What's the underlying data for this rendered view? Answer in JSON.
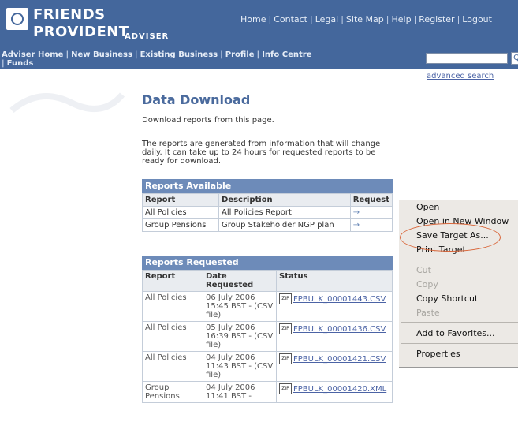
{
  "brand": {
    "name_line1": "FRIENDS",
    "name_line2": "PROVIDENT",
    "section": "ADVISER"
  },
  "top_nav": [
    "Home",
    "Contact",
    "Legal",
    "Site Map",
    "Help",
    "Register",
    "Logout"
  ],
  "main_nav": [
    "Adviser Home",
    "New Business",
    "Existing Business",
    "Profile",
    "Info Centre",
    "Funds"
  ],
  "search": {
    "value": "",
    "go_label": "Q",
    "advanced_link": "advanced search"
  },
  "page": {
    "title": "Data Download",
    "intro": "Download reports from this page.",
    "note": "The reports are generated from information that will change daily. It can take up to 24 hours for requested reports to be ready for download."
  },
  "reports_available": {
    "heading": "Reports Available",
    "columns": [
      "Report",
      "Description",
      "Request"
    ],
    "rows": [
      {
        "report": "All Policies",
        "description": "All Policies Report",
        "request": "→"
      },
      {
        "report": "Group Pensions",
        "description": "Group Stakeholder NGP plan",
        "request": "→"
      }
    ]
  },
  "reports_requested": {
    "heading": "Reports Requested",
    "columns": [
      "Report",
      "Date Requested",
      "Status"
    ],
    "rows": [
      {
        "report": "All Policies",
        "date": "06 July 2006 15:45 BST - (CSV file)",
        "file": "FPBULK_00001443.CSV"
      },
      {
        "report": "All Policies",
        "date": "05 July 2006 16:39 BST - (CSV file)",
        "file": "FPBULK_00001436.CSV"
      },
      {
        "report": "All Policies",
        "date": "04 July 2006 11:43 BST - (CSV file)",
        "file": "FPBULK_00001421.CSV"
      },
      {
        "report": "Group Pensions",
        "date": "04 July 2006 11:41 BST -",
        "file": "FPBULK_00001420.XML"
      }
    ]
  },
  "context_menu": {
    "items": [
      {
        "label": "Open",
        "enabled": true
      },
      {
        "label": "Open in New Window",
        "enabled": true
      },
      {
        "label": "Save Target As...",
        "enabled": true
      },
      {
        "label": "Print Target",
        "enabled": true
      },
      {
        "label": "Cut",
        "enabled": false
      },
      {
        "label": "Copy",
        "enabled": false
      },
      {
        "label": "Copy Shortcut",
        "enabled": true
      },
      {
        "label": "Paste",
        "enabled": false
      },
      {
        "label": "Add to Favorites...",
        "enabled": true
      },
      {
        "label": "Properties",
        "enabled": true
      }
    ]
  },
  "colors": {
    "header": "#44679c",
    "table_bar": "#6d8bb9",
    "link": "#4b63a5",
    "menu_bg": "#ece9e5",
    "highlight_ellipse": "#d9663a"
  }
}
